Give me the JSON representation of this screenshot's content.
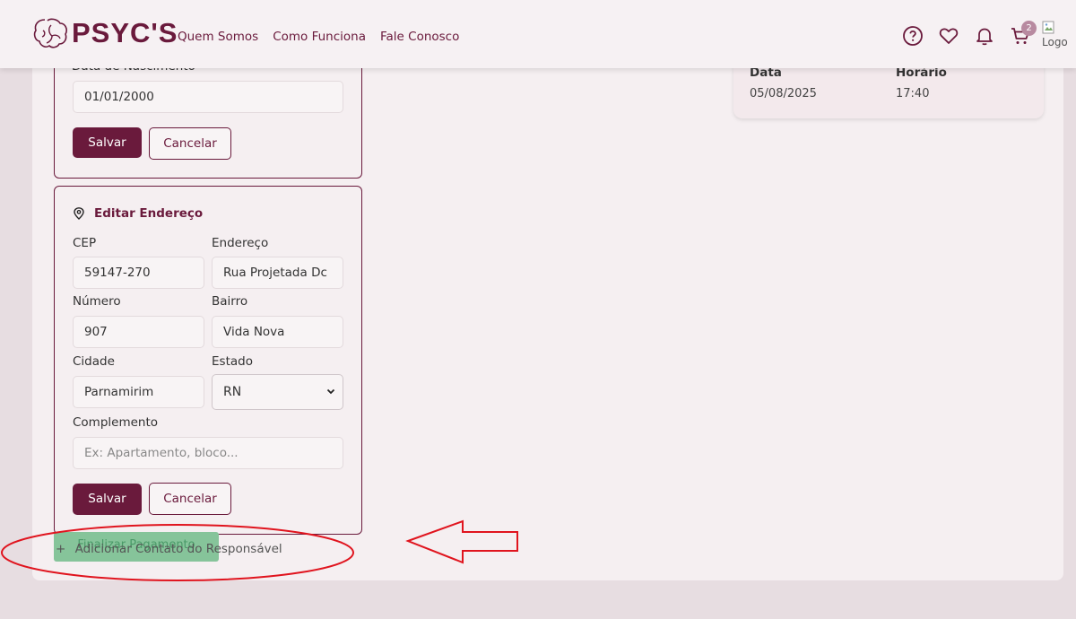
{
  "header": {
    "logo_text": "PSYC'S",
    "nav": [
      "Quem Somos",
      "Como Funciona",
      "Fale Conosco"
    ],
    "cart_count": "2",
    "broken_image_alt": "Logo",
    "icons": [
      "help-circle-icon",
      "heart-icon",
      "bell-icon",
      "cart-icon"
    ]
  },
  "personal": {
    "birth_label": "Data de Nascimento",
    "birth_value": "01/01/2000",
    "save": "Salvar",
    "cancel": "Cancelar"
  },
  "address": {
    "title": "Editar Endereço",
    "cep_label": "CEP",
    "cep_value": "59147-270",
    "endereco_label": "Endereço",
    "endereco_value": "Rua Projetada Dc",
    "numero_label": "Número",
    "numero_value": "907",
    "bairro_label": "Bairro",
    "bairro_value": "Vida Nova",
    "cidade_label": "Cidade",
    "cidade_value": "Parnamirim",
    "estado_label": "Estado",
    "estado_value": "RN",
    "complemento_label": "Complemento",
    "complemento_placeholder": "Ex: Apartamento, bloco...",
    "save": "Salvar",
    "cancel": "Cancelar"
  },
  "summary": {
    "date_label": "Data",
    "date_value": "05/08/2025",
    "time_label": "Horário",
    "time_value": "17:40"
  },
  "bottom": {
    "finalize": "Finalizar Pagamento",
    "add_contact": "Adicionar Contato do Responsável",
    "plus": "+"
  },
  "colors": {
    "brand": "#6a1a3c",
    "page_bg": "#e7dde1",
    "finalize_green": "#86c49a",
    "annotation_red": "#e0141e"
  }
}
